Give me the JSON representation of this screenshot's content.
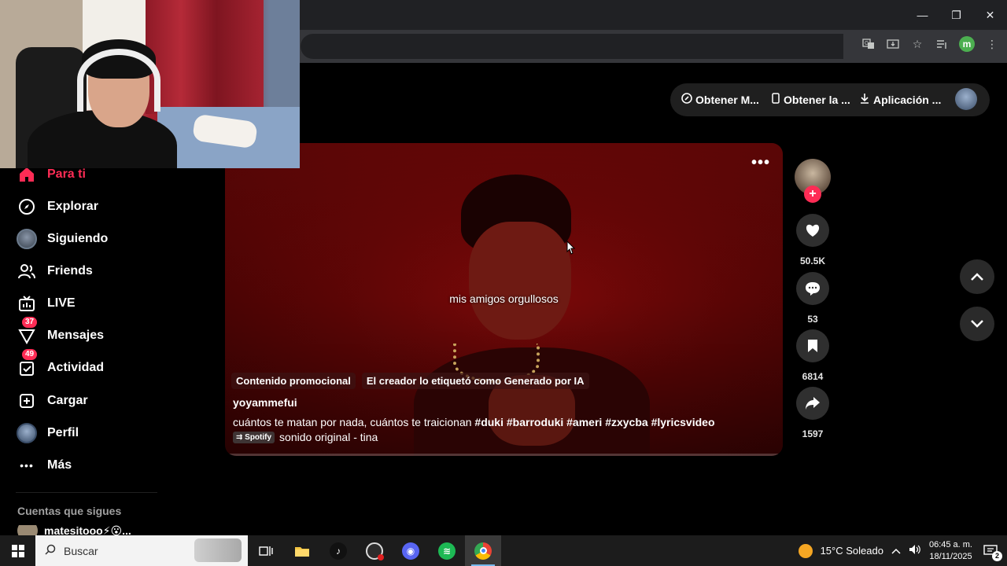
{
  "browser": {
    "window_controls": {
      "minimize": "—",
      "restore": "❐",
      "close": "✕"
    },
    "toolbar_icons": [
      "translate-icon",
      "install-icon",
      "star-icon",
      "reading-list-icon"
    ],
    "profile_initial": "m"
  },
  "header": {
    "buttons": [
      {
        "label": "Obtener M...",
        "icon": "coin-icon"
      },
      {
        "label": "Obtener la ...",
        "icon": "phone-icon"
      },
      {
        "label": "Aplicación ...",
        "icon": "download-icon"
      }
    ]
  },
  "sidebar": {
    "items": [
      {
        "label": "Para ti",
        "icon": "home-icon",
        "active": true
      },
      {
        "label": "Explorar",
        "icon": "compass-icon"
      },
      {
        "label": "Siguiendo",
        "icon": "following-avatar"
      },
      {
        "label": "Friends",
        "icon": "friends-icon"
      },
      {
        "label": "LIVE",
        "icon": "live-icon"
      },
      {
        "label": "Mensajes",
        "icon": "messages-icon",
        "badge": "37"
      },
      {
        "label": "Actividad",
        "icon": "activity-icon",
        "badge": "49"
      },
      {
        "label": "Cargar",
        "icon": "upload-icon"
      },
      {
        "label": "Perfil",
        "icon": "profile-avatar"
      },
      {
        "label": "Más",
        "icon": "more-icon"
      }
    ],
    "following_heading": "Cuentas que sigues",
    "following_first": "matesitooo⚡😮..."
  },
  "video": {
    "subtitle": "mis amigos orgullosos",
    "labels": [
      "Contenido promocional",
      "El creador lo etiquetó como Generado por IA"
    ],
    "author": "yoyammefui",
    "caption_text": "cuántos te matan por nada, cuántos te traicionan",
    "hashtags": [
      "#duki",
      "#barroduki",
      "#ameri",
      "#zxycba",
      "#lyricsvideo"
    ],
    "music_chip": "⇉ Spotify",
    "music": "sonido original - tina",
    "more": "•••"
  },
  "actions": {
    "likes": "50.5K",
    "comments": "53",
    "saves": "6814",
    "shares": "1597"
  },
  "taskbar": {
    "search_placeholder": "Buscar",
    "weather": "15°C Soleado",
    "time": "06:45 a. m.",
    "date": "18/11/2025",
    "notifications": "2"
  },
  "colors": {
    "accent": "#fe2c55",
    "background": "#000000",
    "video_bg": "#5a0505"
  }
}
